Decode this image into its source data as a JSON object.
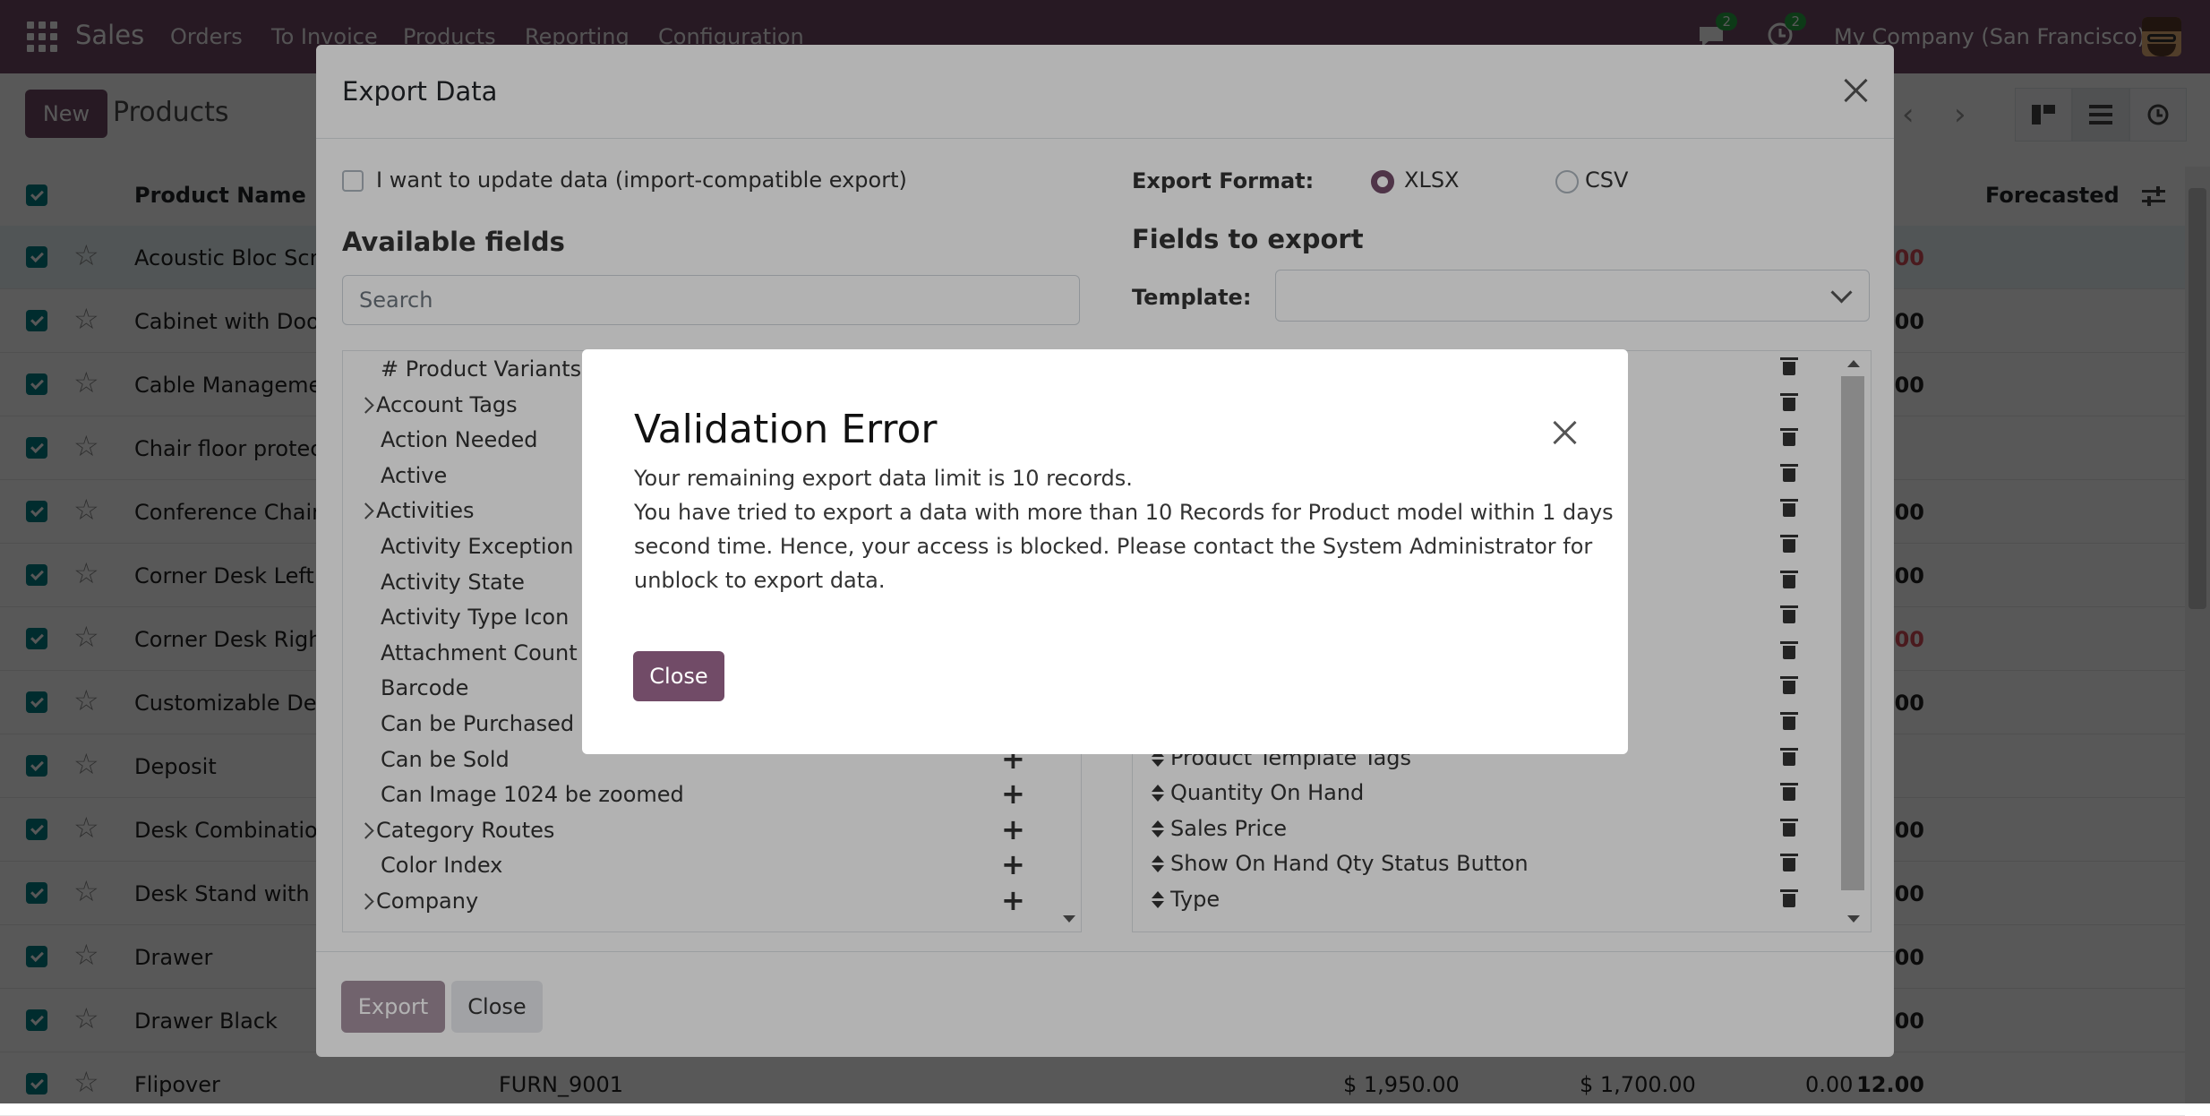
{
  "topnav": {
    "app_name": "Sales",
    "menu": [
      "Orders",
      "To Invoice",
      "Products",
      "Reporting",
      "Configuration"
    ],
    "chat_badge": "2",
    "activity_badge": "2",
    "company": "My Company (San Francisco)"
  },
  "control": {
    "new_label": "New",
    "breadcrumb": "Products"
  },
  "list": {
    "col_name": "Product Name",
    "col_forecast": "Forecasted",
    "rows": [
      {
        "name": "Acoustic Bloc Scre",
        "ref": "",
        "price1": "",
        "price2": "",
        "qty": "",
        "forecast": "-4.00"
      },
      {
        "name": "Cabinet with Doors",
        "ref": "",
        "price1": "",
        "price2": "",
        "qty": "",
        "forecast": "138.00"
      },
      {
        "name": "Cable Management",
        "ref": "",
        "price1": "",
        "price2": "",
        "qty": "",
        "forecast": "90.00"
      },
      {
        "name": "Chair floor protec",
        "ref": "",
        "price1": "",
        "price2": "",
        "qty": "",
        "forecast": ""
      },
      {
        "name": "Conference Chair",
        "ref": "",
        "price1": "",
        "price2": "",
        "qty": "",
        "forecast": "56.00"
      },
      {
        "name": "Corner Desk Left S",
        "ref": "",
        "price1": "",
        "price2": "",
        "qty": "",
        "forecast": "2.00"
      },
      {
        "name": "Corner Desk Right",
        "ref": "",
        "price1": "",
        "price2": "",
        "qty": "",
        "forecast": "-10.00"
      },
      {
        "name": "Customizable Des",
        "ref": "",
        "price1": "",
        "price2": "",
        "qty": "",
        "forecast": "285.00"
      },
      {
        "name": "Deposit",
        "ref": "",
        "price1": "",
        "price2": "",
        "qty": "",
        "forecast": ""
      },
      {
        "name": "Desk Combination",
        "ref": "",
        "price1": "",
        "price2": "",
        "qty": "",
        "forecast": "4.00"
      },
      {
        "name": "Desk Stand with S",
        "ref": "",
        "price1": "",
        "price2": "",
        "qty": "",
        "forecast": "125.00"
      },
      {
        "name": "Drawer",
        "ref": "",
        "price1": "",
        "price2": "",
        "qty": "",
        "forecast": "65.00"
      },
      {
        "name": "Drawer Black",
        "ref": "",
        "price1": "",
        "price2": "",
        "qty": "",
        "forecast": "0.00"
      },
      {
        "name": "Flipover",
        "ref": "FURN_9001",
        "price1": "$ 1,950.00",
        "price2": "$ 1,700.00",
        "qty": "0.00",
        "forecast": "12.00"
      }
    ]
  },
  "export_dialog": {
    "title": "Export Data",
    "import_compat_label": "I want to update data (import-compatible export)",
    "format_label": "Export Format:",
    "format_xlsx": "XLSX",
    "format_csv": "CSV",
    "available_title": "Available fields",
    "search_placeholder": "Search",
    "fields_title": "Fields to export",
    "template_label": "Template:",
    "available_fields": [
      {
        "label": "# Product Variants",
        "expandable": false,
        "plus": false
      },
      {
        "label": "Account Tags",
        "expandable": true,
        "plus": false
      },
      {
        "label": "Action Needed",
        "expandable": false,
        "plus": false
      },
      {
        "label": "Active",
        "expandable": false,
        "plus": false
      },
      {
        "label": "Activities",
        "expandable": true,
        "plus": false
      },
      {
        "label": "Activity Exception D",
        "expandable": false,
        "plus": false
      },
      {
        "label": "Activity State",
        "expandable": false,
        "plus": false
      },
      {
        "label": "Activity Type Icon",
        "expandable": false,
        "plus": false
      },
      {
        "label": "Attachment Count",
        "expandable": false,
        "plus": false
      },
      {
        "label": "Barcode",
        "expandable": false,
        "plus": false
      },
      {
        "label": "Can be Purchased",
        "expandable": false,
        "plus": false
      },
      {
        "label": "Can be Sold",
        "expandable": false,
        "plus": true
      },
      {
        "label": "Can Image 1024 be zoomed",
        "expandable": false,
        "plus": true
      },
      {
        "label": "Category Routes",
        "expandable": true,
        "plus": true
      },
      {
        "label": "Color Index",
        "expandable": false,
        "plus": true
      },
      {
        "label": "Company",
        "expandable": true,
        "plus": true
      }
    ],
    "export_fields": [
      "Product Template Tags",
      "Quantity On Hand",
      "Sales Price",
      "Show On Hand Qty Status Button",
      "Type"
    ],
    "export_btn": "Export",
    "close_btn": "Close"
  },
  "validation": {
    "title": "Validation Error",
    "lines": [
      "Your remaining export data limit is 10 records.",
      "You have tried to export a data with more than 10 Records for Product model within 1 days",
      "second time. Hence, your access is blocked. Please contact the System Administrator for",
      "unblock to export data."
    ],
    "close_btn": "Close"
  },
  "colors": {
    "brand": "#714b67",
    "checkbox": "#017e84",
    "negative": "#d44c59"
  }
}
